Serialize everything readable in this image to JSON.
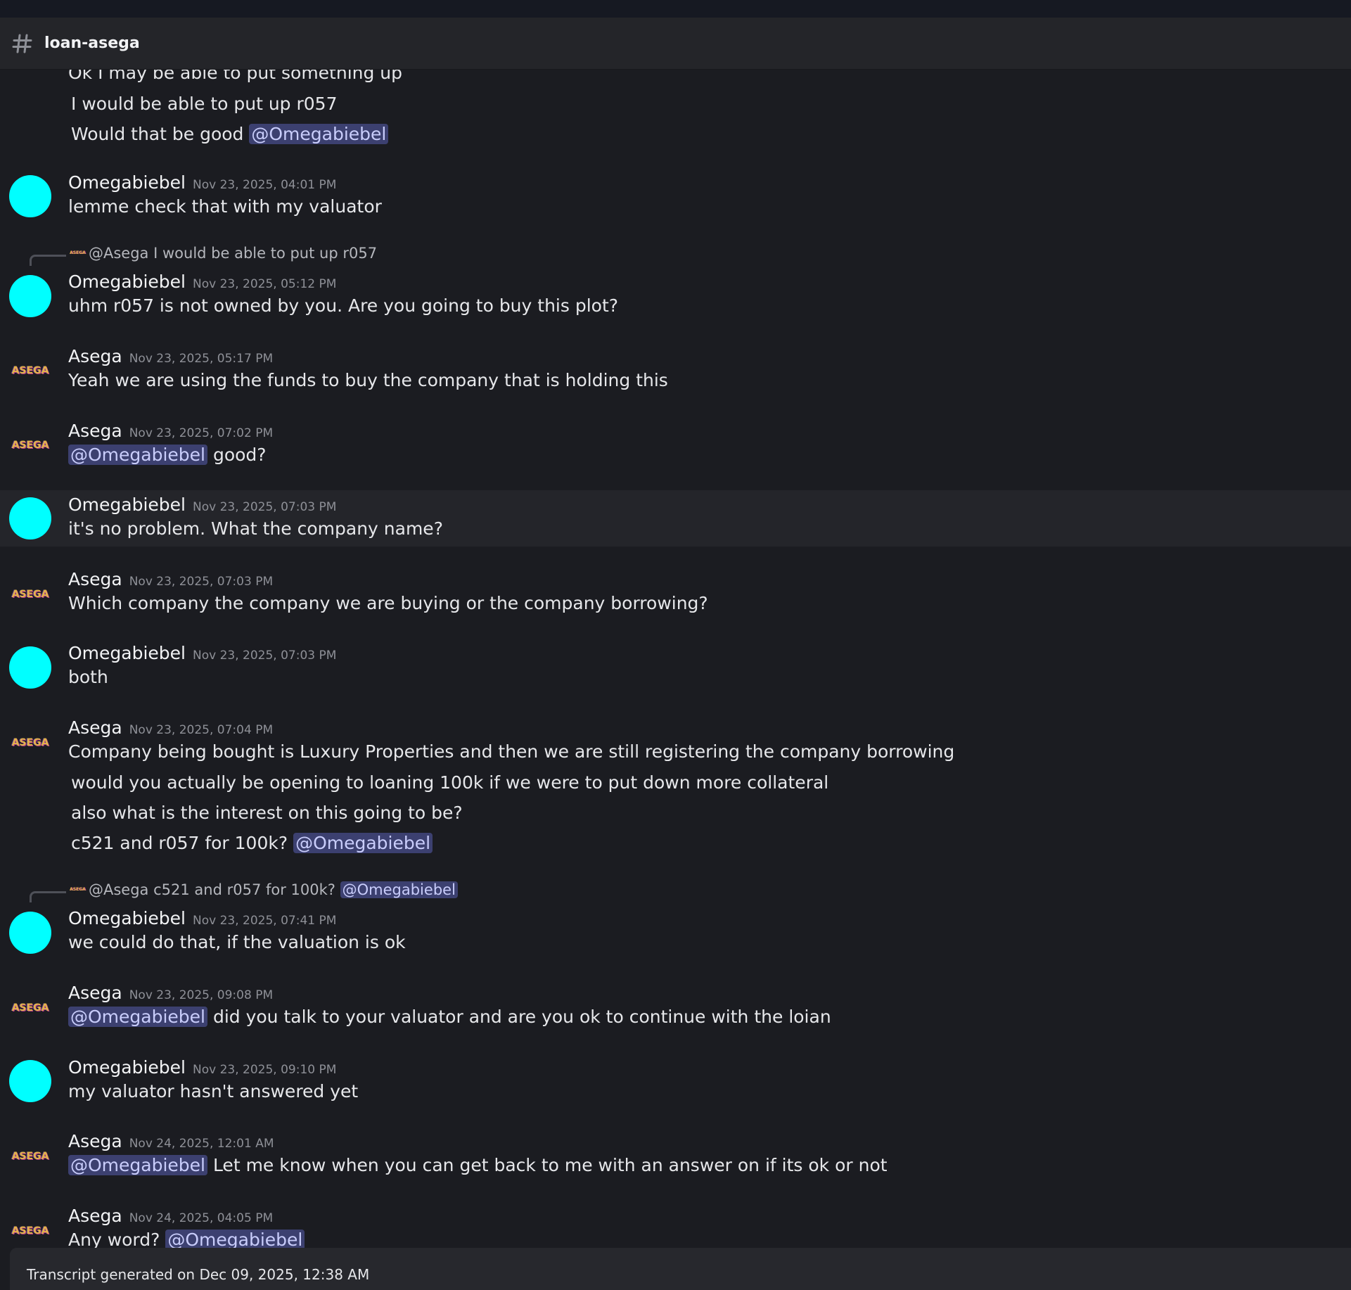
{
  "channel": {
    "name": "loan-asega",
    "icon": "hash-icon"
  },
  "colors": {
    "background": "#1b1c21",
    "header": "#242529",
    "omega_avatar": "#00ffff",
    "mention_bg": "#3c4070",
    "mention_text": "#c9cdfb"
  },
  "asega_avatar_text": "ASEGA",
  "continued": {
    "lines": [
      "Ok I may be able to put something up",
      "I would be able to put up r057",
      "Would that be good "
    ],
    "mention": "@Omegabiebel"
  },
  "messages": [
    {
      "author": "Omegabiebel",
      "time": "Nov 23, 2025, 04:01 PM",
      "text": "lemme check that with my valuator"
    },
    {
      "reply": {
        "author": "@Asega",
        "text": "I would be able to put up r057"
      },
      "author": "Omegabiebel",
      "time": "Nov 23, 2025, 05:12 PM",
      "text": "uhm r057 is not owned by you. Are you going to buy this plot?"
    },
    {
      "author": "Asega",
      "time": "Nov 23, 2025, 05:17 PM",
      "text": "Yeah we are using the funds to buy the company that is holding this"
    },
    {
      "author": "Asega",
      "time": "Nov 23, 2025, 07:02 PM",
      "mention": "@Omegabiebel",
      "text": " good?"
    },
    {
      "author": "Omegabiebel",
      "time": "Nov 23, 2025, 07:03 PM",
      "text": "it's no problem. What the company name?"
    },
    {
      "author": "Asega",
      "time": "Nov 23, 2025, 07:03 PM",
      "text": "Which company the company we are buying or the company borrowing?"
    },
    {
      "author": "Omegabiebel",
      "time": "Nov 23, 2025, 07:03 PM",
      "text": "both"
    },
    {
      "author": "Asega",
      "time": "Nov 23, 2025, 07:04 PM",
      "text": "Company being bought is Luxury Properties and then we are still registering the company borrowing",
      "extra": [
        "would you actually be opening to loaning 100k if we were to put down more collateral",
        "also what is the interest on this going to be?",
        "c521 and r057 for 100k? "
      ],
      "extra_mention": "@Omegabiebel"
    },
    {
      "reply": {
        "author": "@Asega",
        "text": "c521 and r057 for 100k? ",
        "mention": "@Omegabiebel"
      },
      "author": "Omegabiebel",
      "time": "Nov 23, 2025, 07:41 PM",
      "text": "we could do that, if the valuation is ok"
    },
    {
      "author": "Asega",
      "time": "Nov 23, 2025, 09:08 PM",
      "mention": "@Omegabiebel",
      "text": " did you talk to your valuator and are you ok to continue with the loian"
    },
    {
      "author": "Omegabiebel",
      "time": "Nov 23, 2025, 09:10 PM",
      "text": "my valuator hasn't answered yet"
    },
    {
      "author": "Asega",
      "time": "Nov 24, 2025, 12:01 AM",
      "mention": "@Omegabiebel",
      "text": " Let me know when you can get back to me with an answer on if its ok or not"
    },
    {
      "author": "Asega",
      "time": "Nov 24, 2025, 04:05 PM",
      "text": "Any word? ",
      "mention_after": "@Omegabiebel"
    }
  ],
  "footer": {
    "text": "Transcript generated on Dec 09, 2025, 12:38 AM"
  }
}
